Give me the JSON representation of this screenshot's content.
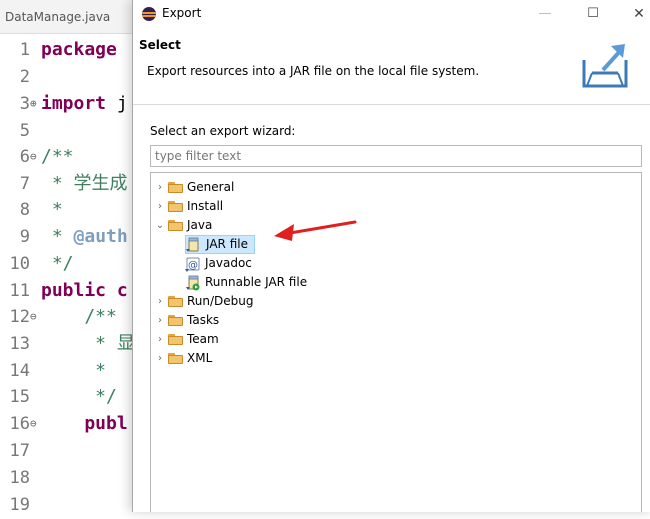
{
  "editor": {
    "tab_label": "DataManage.java",
    "lines": [
      {
        "num": "1",
        "fold": "",
        "segments": [
          {
            "t": "package ",
            "c": "kw"
          }
        ]
      },
      {
        "num": "2",
        "fold": "",
        "segments": []
      },
      {
        "num": "3",
        "fold": "⊕",
        "segments": [
          {
            "t": "import ",
            "c": "kw"
          },
          {
            "t": "j",
            "c": ""
          }
        ]
      },
      {
        "num": "5",
        "fold": "",
        "segments": []
      },
      {
        "num": "6",
        "fold": "⊖",
        "segments": [
          {
            "t": "/**",
            "c": "cm"
          }
        ]
      },
      {
        "num": "7",
        "fold": "",
        "segments": [
          {
            "t": " * 学生成",
            "c": "cm"
          }
        ]
      },
      {
        "num": "8",
        "fold": "",
        "segments": [
          {
            "t": " *",
            "c": "cm"
          }
        ]
      },
      {
        "num": "9",
        "fold": "",
        "segments": [
          {
            "t": " * ",
            "c": "cm"
          },
          {
            "t": "@auth",
            "c": "tag"
          }
        ]
      },
      {
        "num": "10",
        "fold": "",
        "segments": [
          {
            "t": " */",
            "c": "cm"
          }
        ]
      },
      {
        "num": "11",
        "fold": "",
        "segments": [
          {
            "t": "public c",
            "c": "kw"
          }
        ]
      },
      {
        "num": "12",
        "fold": "⊖",
        "segments": [
          {
            "t": "    /**",
            "c": "cm"
          }
        ]
      },
      {
        "num": "13",
        "fold": "",
        "segments": [
          {
            "t": "     * 显",
            "c": "cm"
          }
        ]
      },
      {
        "num": "14",
        "fold": "",
        "segments": [
          {
            "t": "     *",
            "c": "cm"
          }
        ]
      },
      {
        "num": "15",
        "fold": "",
        "segments": [
          {
            "t": "     */",
            "c": "cm"
          }
        ]
      },
      {
        "num": "16",
        "fold": "⊖",
        "segments": [
          {
            "t": "    publ",
            "c": "kw"
          }
        ]
      },
      {
        "num": "17",
        "fold": "",
        "segments": []
      },
      {
        "num": "18",
        "fold": "",
        "segments": []
      },
      {
        "num": "19",
        "fold": "",
        "segments": []
      }
    ]
  },
  "dialog": {
    "title": "Export",
    "window_buttons": {
      "minimize": "—",
      "maximize": "☐",
      "close": "✕"
    },
    "page_title": "Select",
    "page_description": "Export resources into a JAR file on the local file system.",
    "wizard_label": "Select an export wizard:",
    "filter_placeholder": "type filter text",
    "tree": {
      "general": {
        "label": "General",
        "chevron": "›"
      },
      "install": {
        "label": "Install",
        "chevron": "›"
      },
      "java": {
        "label": "Java",
        "chevron": "⌄",
        "children": {
          "jar": {
            "label": "JAR file"
          },
          "javadoc": {
            "label": "Javadoc"
          },
          "runnable": {
            "label": "Runnable JAR file"
          }
        }
      },
      "run_debug": {
        "label": "Run/Debug",
        "chevron": "›"
      },
      "tasks": {
        "label": "Tasks",
        "chevron": "›"
      },
      "team": {
        "label": "Team",
        "chevron": "›"
      },
      "xml": {
        "label": "XML",
        "chevron": "›"
      }
    },
    "selected_item": "JAR file"
  },
  "colors": {
    "annotation_arrow": "#e02020",
    "selection_bg": "#cce8ff",
    "keyword": "#7f0055",
    "comment": "#3f7f5f"
  }
}
